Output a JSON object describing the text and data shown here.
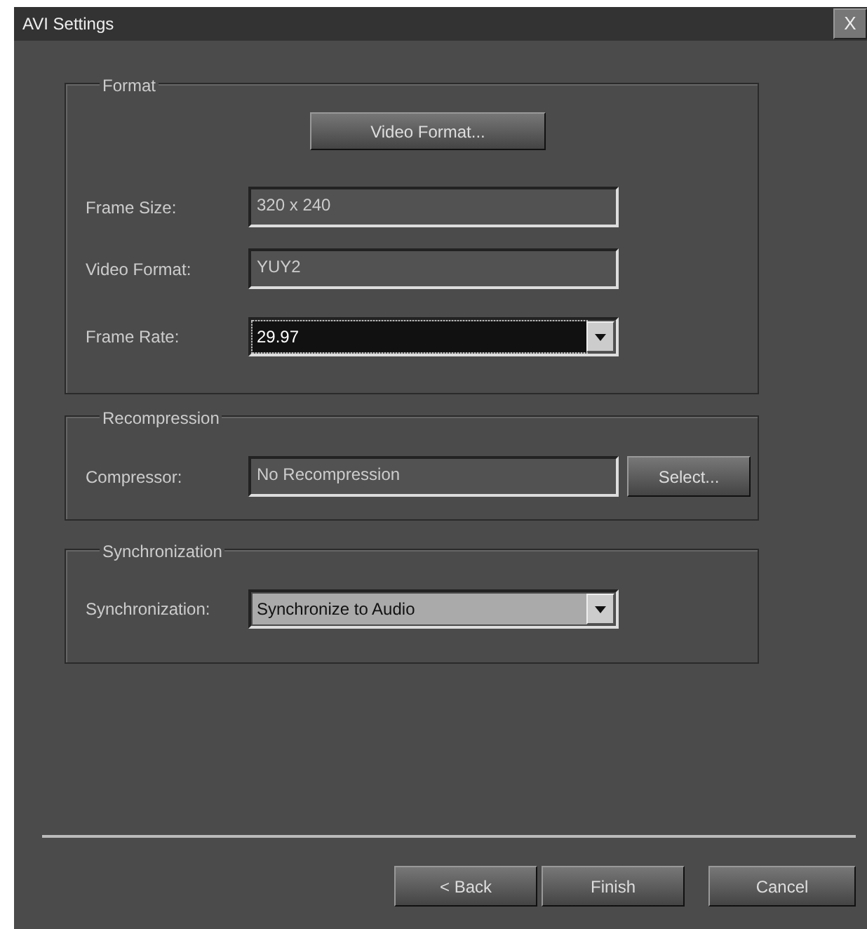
{
  "window": {
    "title": "AVI Settings",
    "close": "X"
  },
  "groups": [
    {
      "title": "Format",
      "button": "Video Format...",
      "fields": [
        {
          "label": "Frame Size:",
          "kind": "text",
          "value": "320 x 240"
        },
        {
          "label": "Video Format:",
          "kind": "text",
          "value": "YUY2"
        },
        {
          "label": "Frame Rate:",
          "kind": "dropdown",
          "value": "29.97",
          "focused": true
        }
      ]
    },
    {
      "title": "Recompression",
      "fields": [
        {
          "label": "Compressor:",
          "kind": "text",
          "value": "No Recompression",
          "button": "Select..."
        }
      ]
    },
    {
      "title": "Synchronization",
      "fields": [
        {
          "label": "Synchronization:",
          "kind": "dropdown",
          "value": "Synchronize to Audio",
          "focused": false
        }
      ]
    }
  ],
  "buttons": [
    "< Back",
    "Finish",
    "Cancel"
  ]
}
